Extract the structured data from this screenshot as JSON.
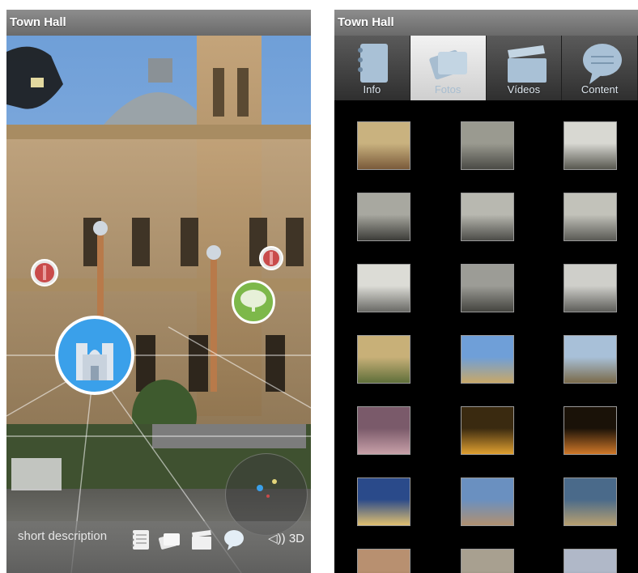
{
  "left_screen": {
    "title": "Town Hall",
    "poi_markers": [
      {
        "icon": "pin-icon",
        "accent": "#c94b4b"
      },
      {
        "icon": "pin-icon",
        "accent": "#c94b4b"
      },
      {
        "icon": "tree-icon",
        "accent": "#7db84a"
      },
      {
        "icon": "cathedral-icon",
        "accent": "#3aa0ea"
      }
    ],
    "bottom_bar": {
      "short_description": "short description",
      "icons": [
        "notebook-icon",
        "photos-icon",
        "clapperboard-icon",
        "speech-bubble-icon"
      ],
      "sound_label": "3D",
      "sound_icon": "speaker-icon"
    },
    "radar_icon": "radar-icon"
  },
  "right_screen": {
    "title": "Town Hall",
    "tabs": [
      {
        "label": "Info",
        "icon": "notebook-icon",
        "active": false
      },
      {
        "label": "Fotos",
        "icon": "photos-icon",
        "active": true
      },
      {
        "label": "Vídeos",
        "icon": "clapperboard-icon",
        "active": false
      },
      {
        "label": "Content",
        "icon": "speech-bubble-icon",
        "active": false
      }
    ],
    "gallery": {
      "thumbnails": [
        "photo-thumbnail",
        "photo-thumbnail",
        "photo-thumbnail",
        "photo-thumbnail",
        "photo-thumbnail",
        "photo-thumbnail",
        "photo-thumbnail",
        "photo-thumbnail",
        "photo-thumbnail",
        "photo-thumbnail",
        "photo-thumbnail",
        "photo-thumbnail",
        "photo-thumbnail",
        "photo-thumbnail",
        "photo-thumbnail",
        "photo-thumbnail",
        "photo-thumbnail",
        "photo-thumbnail",
        "photo-thumbnail",
        "photo-thumbnail",
        "photo-thumbnail"
      ]
    }
  },
  "colors": {
    "titlebar": "#7a7a7a",
    "accent_blue": "#3aa0ea",
    "marker_red": "#c94b4b",
    "marker_green": "#7db84a",
    "tab_active": "#e6e6e6"
  }
}
